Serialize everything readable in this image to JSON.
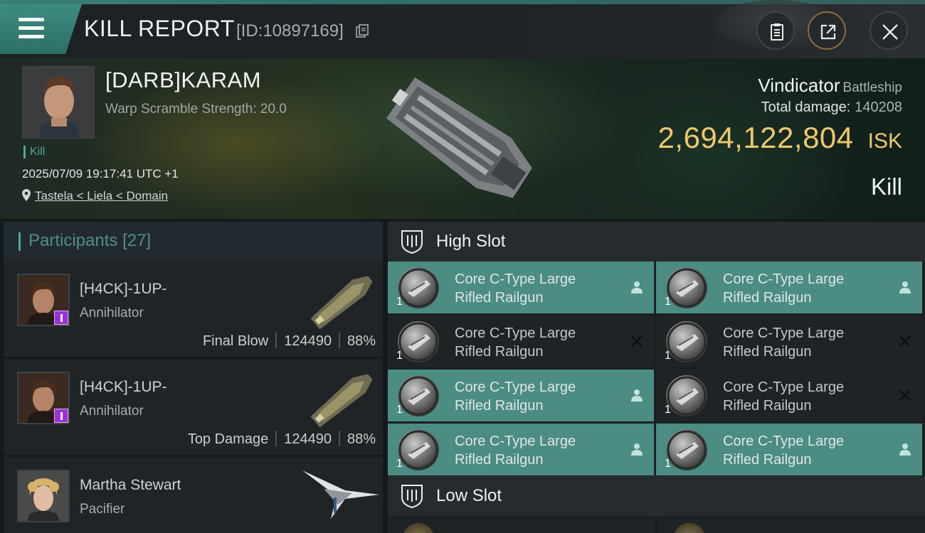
{
  "header": {
    "title": "KILL REPORT",
    "report_id": "[ID:10897169]"
  },
  "victim": {
    "name": "[DARB]KARAM",
    "warp_scramble": "Warp Scramble Strength: 20.0",
    "tag": "Kill",
    "timestamp": "2025/07/09 19:17:41 UTC +1",
    "location": "Tastela < Liela < Domain",
    "ship_name": "Vindicator",
    "ship_class": "Battleship",
    "total_damage_label": "Total damage:",
    "total_damage_value": "140208",
    "isk_value": "2,694,122,804",
    "isk_unit": "ISK",
    "result": "Kill"
  },
  "participants": {
    "label": "Participants",
    "count": "[27]",
    "rows": [
      {
        "name": "[H4CK]-1UP-",
        "ship": "Annihilator",
        "role": "Final Blow",
        "damage": "124490",
        "percent": "88%"
      },
      {
        "name": "[H4CK]-1UP-",
        "ship": "Annihilator",
        "role": "Top Damage",
        "damage": "124490",
        "percent": "88%"
      },
      {
        "name": "Martha Stewart",
        "ship": "Pacifier"
      }
    ]
  },
  "fitting": {
    "high_slot_label": "High Slot",
    "low_slot_label": "Low Slot",
    "high_slot": [
      {
        "name_line1": "Core C-Type Large",
        "name_line2": "Rifled Railgun",
        "qty": "1",
        "status": "dropped"
      },
      {
        "name_line1": "Core C-Type Large",
        "name_line2": "Rifled Railgun",
        "qty": "1",
        "status": "dropped"
      },
      {
        "name_line1": "Core C-Type Large",
        "name_line2": "Rifled Railgun",
        "qty": "1",
        "status": "destroyed"
      },
      {
        "name_line1": "Core C-Type Large",
        "name_line2": "Rifled Railgun",
        "qty": "1",
        "status": "destroyed"
      },
      {
        "name_line1": "Core C-Type Large",
        "name_line2": "Rifled Railgun",
        "qty": "1",
        "status": "dropped"
      },
      {
        "name_line1": "Core C-Type Large",
        "name_line2": "Rifled Railgun",
        "qty": "1",
        "status": "destroyed"
      },
      {
        "name_line1": "Core C-Type Large",
        "name_line2": "Rifled Railgun",
        "qty": "1",
        "status": "dropped"
      },
      {
        "name_line1": "Core C-Type Large",
        "name_line2": "Rifled Railgun",
        "qty": "1",
        "status": "dropped"
      }
    ]
  },
  "colors": {
    "accent_teal": "#4b8c83",
    "isk_gold": "#f0c86a",
    "badge_purple": "#9c2fd8"
  },
  "icons": {
    "menu": "hamburger-menu-icon",
    "copy": "copy-icon",
    "clipboard": "clipboard-icon",
    "share": "share-icon",
    "close": "close-icon",
    "location": "location-pin-icon",
    "slot": "high-slot-icon",
    "dropped": "person-icon",
    "destroyed": "x-icon"
  }
}
